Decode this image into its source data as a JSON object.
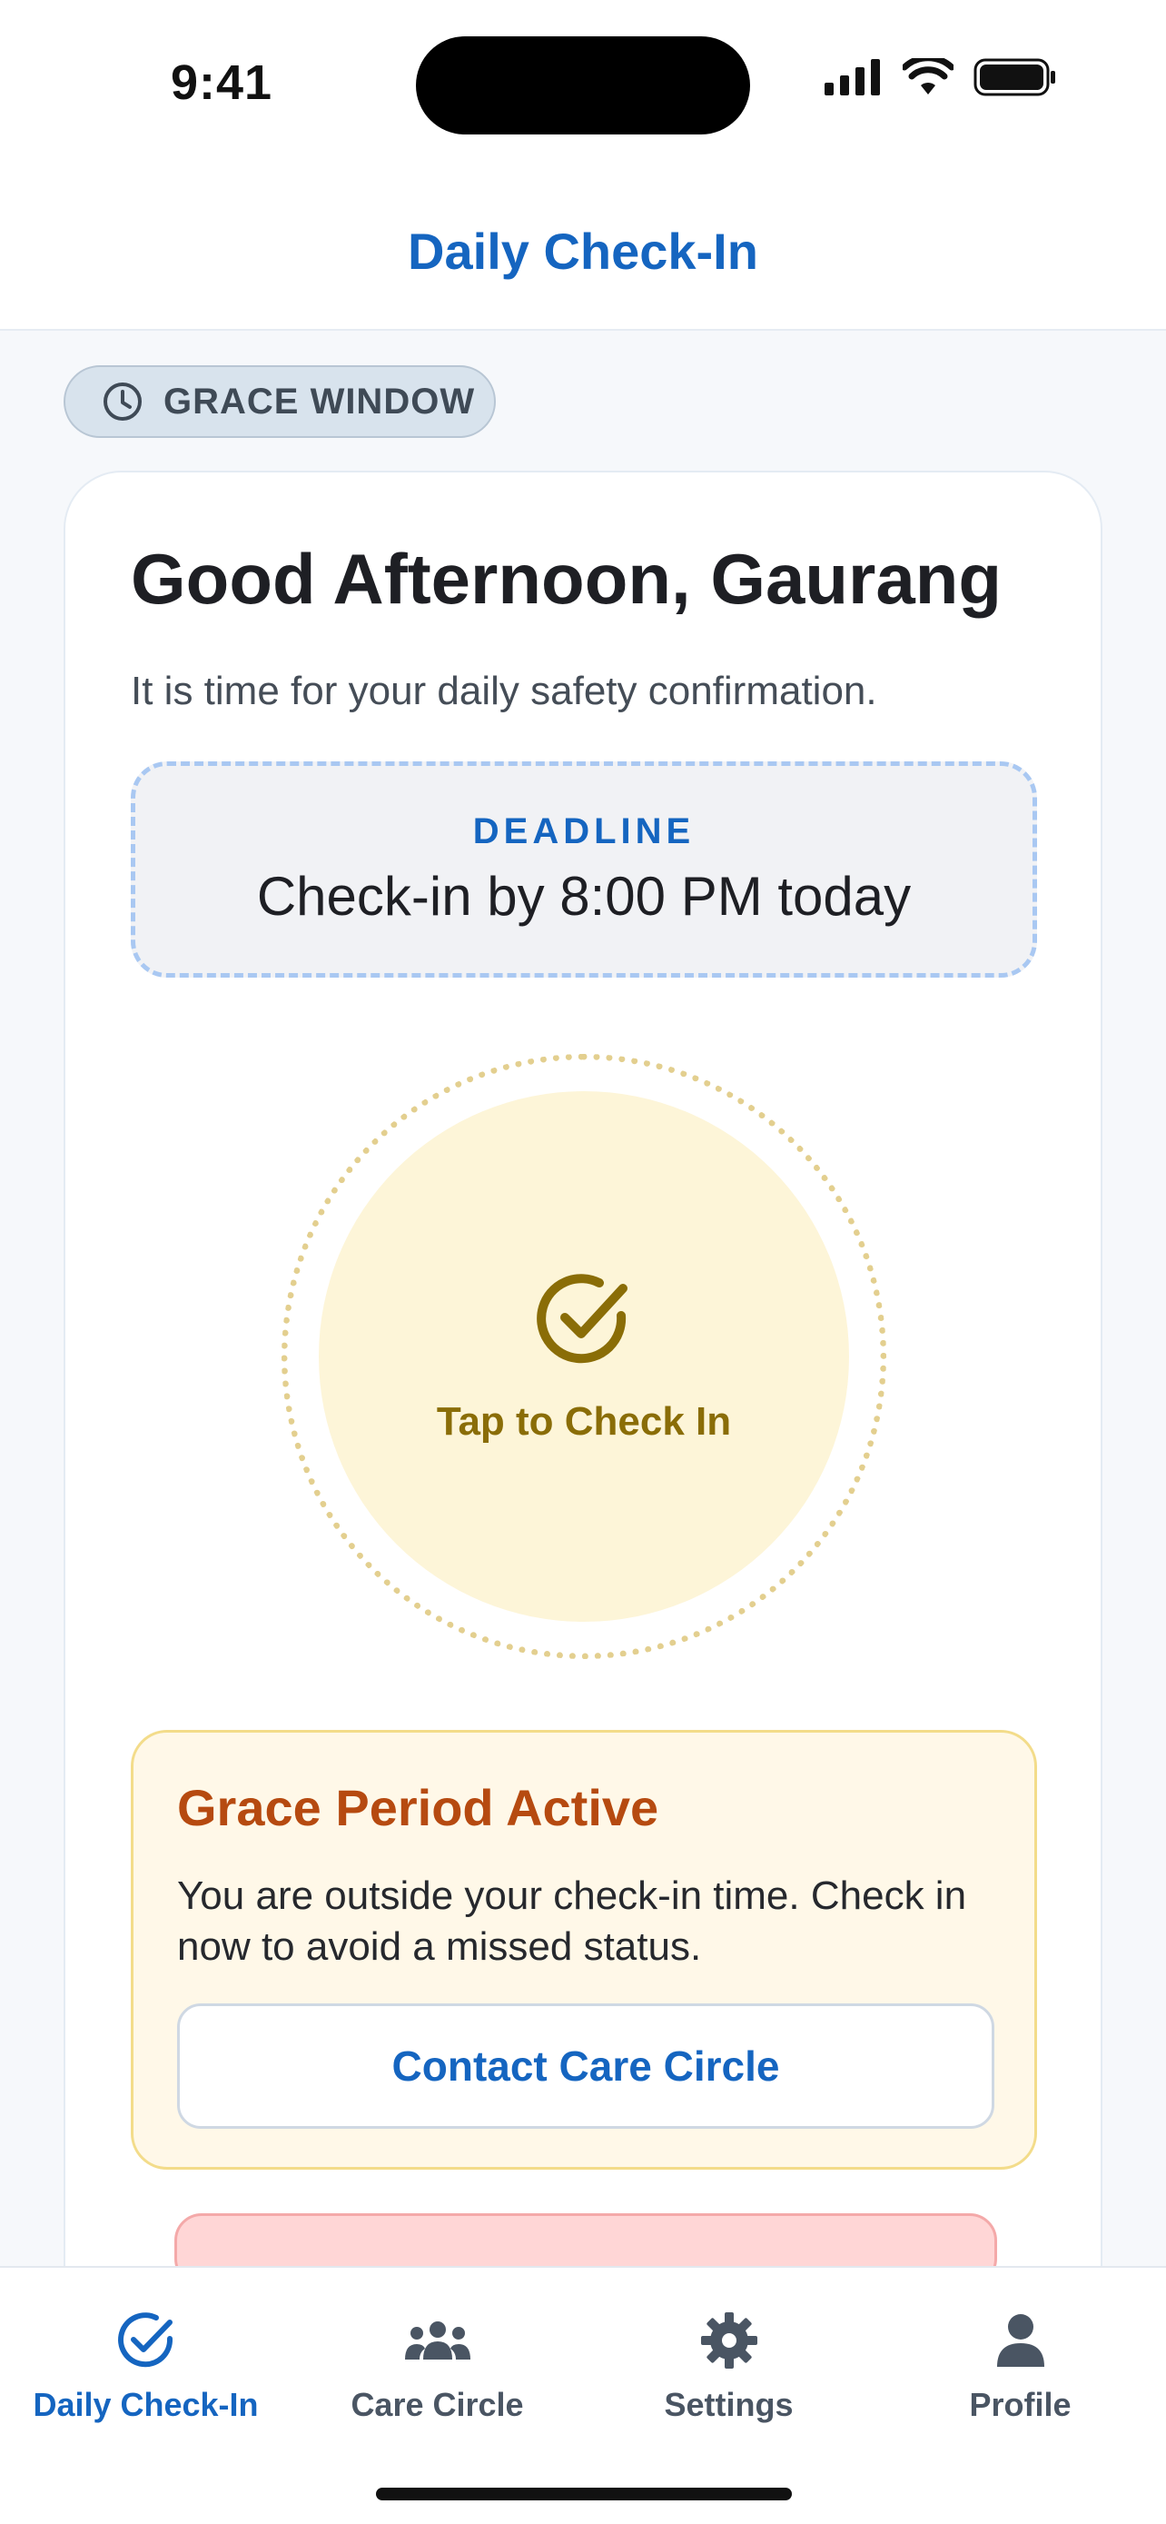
{
  "status_bar": {
    "time": "9:41"
  },
  "header": {
    "title": "Daily Check-In"
  },
  "grace_pill": {
    "label": "GRACE WINDOW",
    "icon": "clock-icon"
  },
  "card": {
    "greeting": "Good Afternoon, Gaurang",
    "subtitle": "It is time for your daily safety confirmation.",
    "deadline": {
      "label": "DEADLINE",
      "text": "Check-in by 8:00 PM today"
    },
    "checkin_button": {
      "label": "Tap to Check In",
      "icon": "check-circle-icon"
    },
    "grace_notice": {
      "title": "Grace Period Active",
      "message": "You are outside your check-in time. Check in now to avoid a missed status.",
      "contact_button": "Contact Care Circle"
    }
  },
  "tabs": [
    {
      "label": "Daily Check-In",
      "icon": "check-circle-icon",
      "active": true
    },
    {
      "label": "Care Circle",
      "icon": "people-icon",
      "active": false
    },
    {
      "label": "Settings",
      "icon": "gear-icon",
      "active": false
    },
    {
      "label": "Profile",
      "icon": "person-icon",
      "active": false
    }
  ],
  "colors": {
    "accent": "#1565c0",
    "checkin_gold": "#8a6d07",
    "grace_orange": "#b64a10",
    "alert_red": "#ffd6d6"
  }
}
